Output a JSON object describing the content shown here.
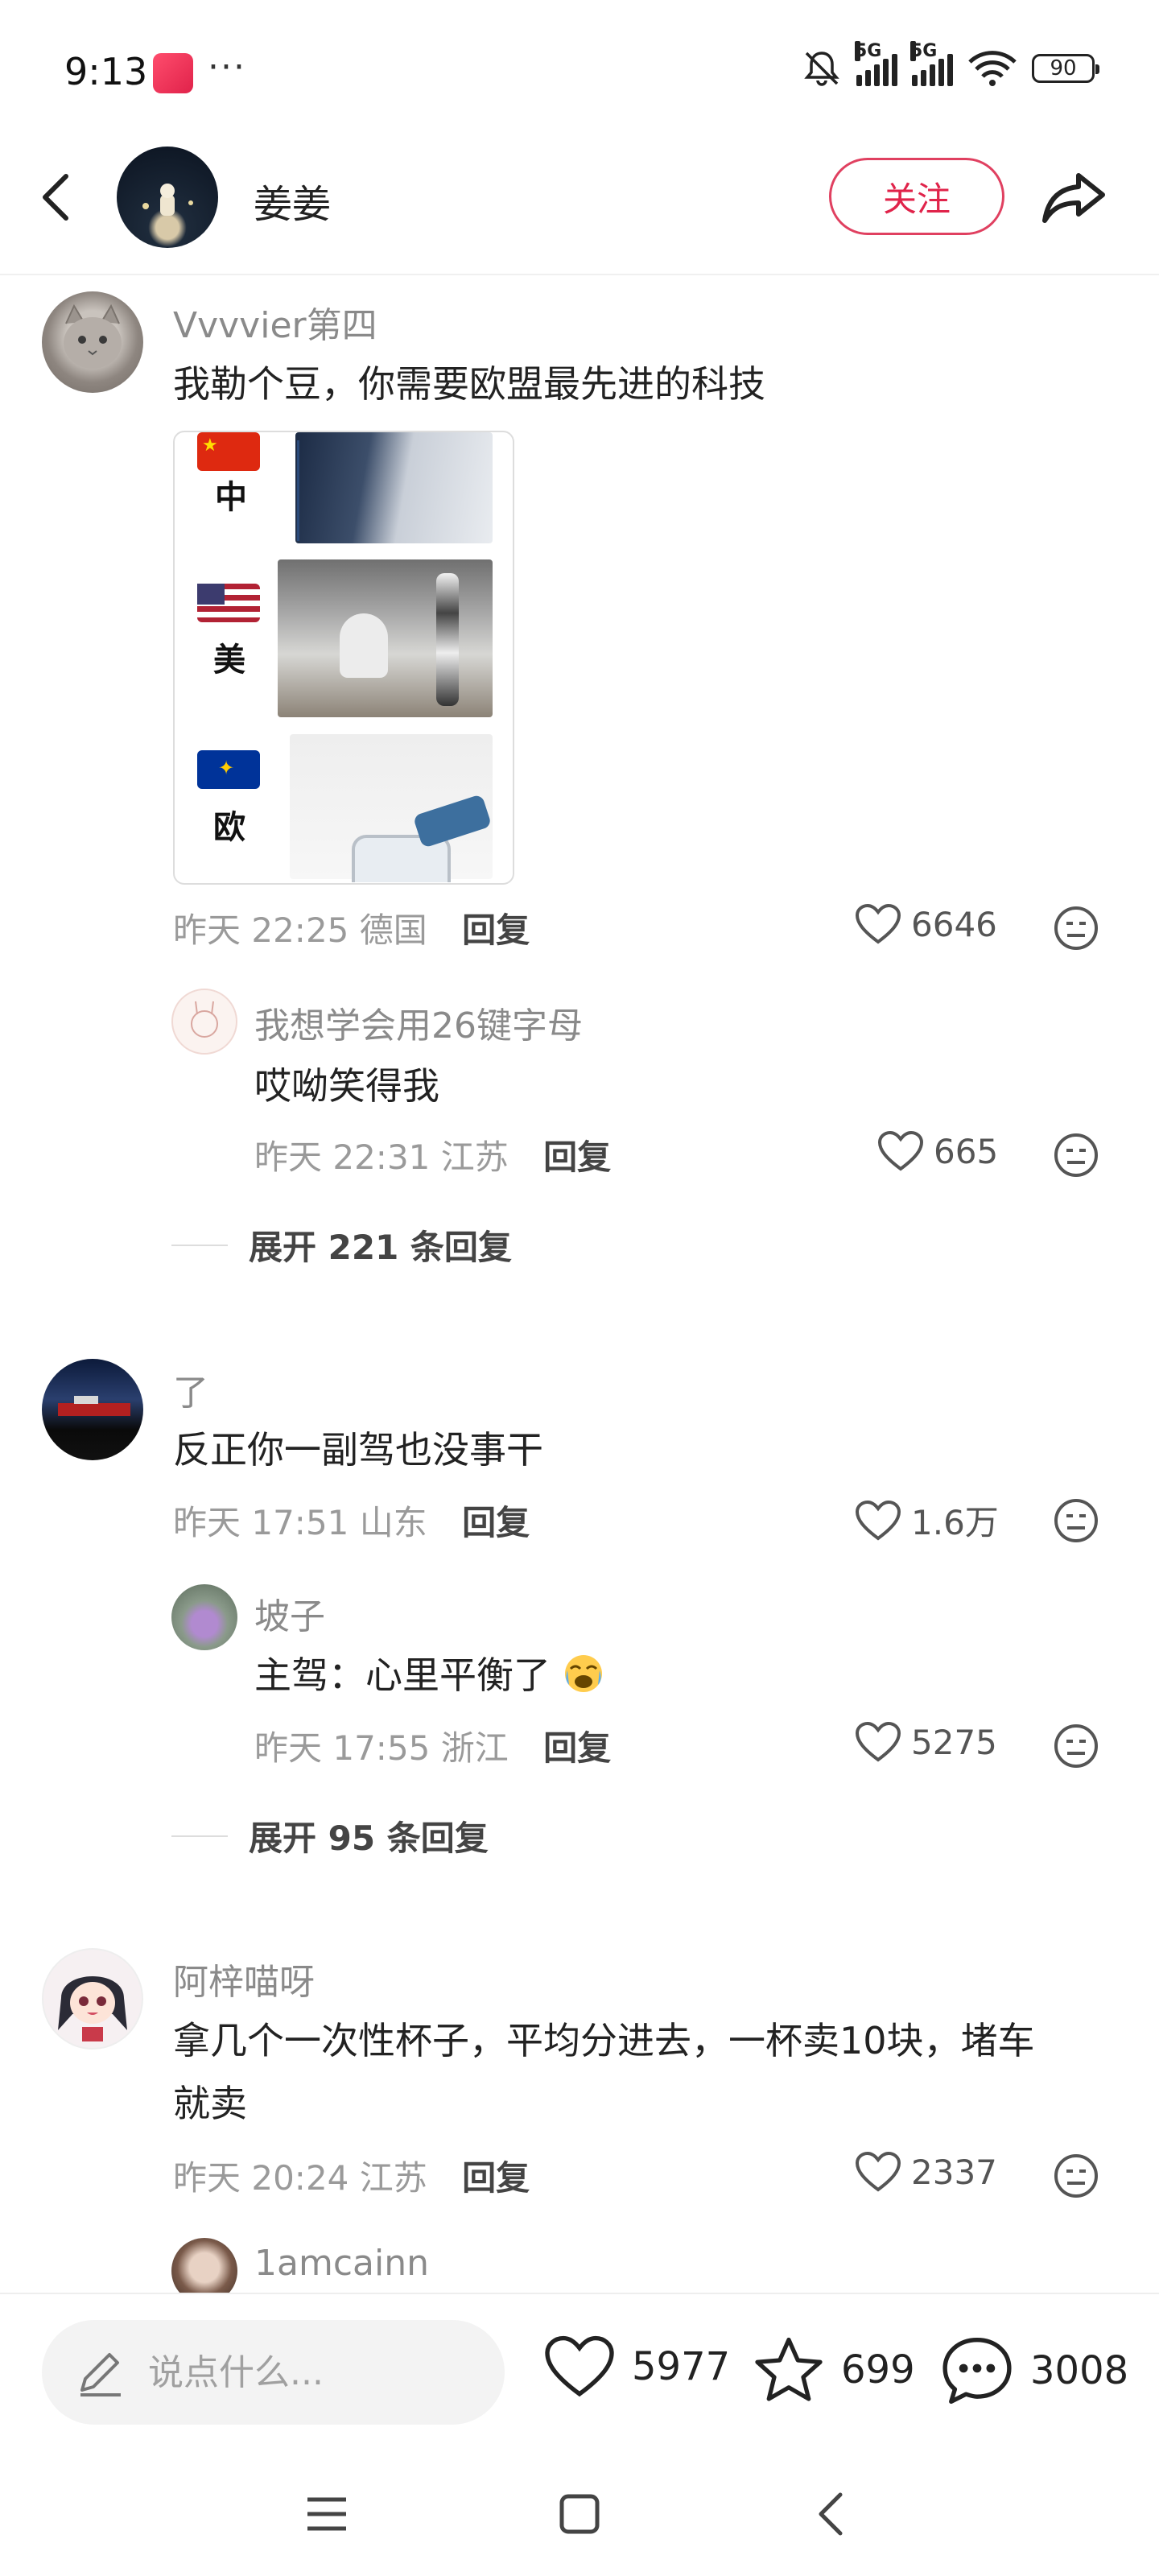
{
  "status_bar": {
    "time": "9:13",
    "dots": "···",
    "network_1": "5G",
    "network_2": "5G",
    "battery": "90"
  },
  "header": {
    "author_name": "姜姜",
    "follow_label": "关注"
  },
  "comments": [
    {
      "user": "Vvvvier第四",
      "text": "我勒个豆，你需要欧盟最先进的科技",
      "meme_labels": [
        "中",
        "美",
        "欧"
      ],
      "time": "昨天 22:25",
      "location": "德国",
      "reply_label": "回复",
      "likes": "6646",
      "reply": {
        "user": "我想学会用26键字母",
        "text": "哎呦笑得我",
        "time": "昨天 22:31",
        "location": "江苏",
        "reply_label": "回复",
        "likes": "665"
      },
      "expand": "展开 221 条回复"
    },
    {
      "user": "了",
      "text": "反正你一副驾也没事干",
      "time": "昨天 17:51",
      "location": "山东",
      "reply_label": "回复",
      "likes": "1.6万",
      "reply": {
        "user": "坡子",
        "text": "主驾：心里平衡了",
        "time": "昨天 17:55",
        "location": "浙江",
        "reply_label": "回复",
        "likes": "5275"
      },
      "expand": "展开 95 条回复"
    },
    {
      "user": "阿梓喵呀",
      "text_line1": "拿几个一次性杯子，平均分进去，一杯卖10块，堵车",
      "text_line2": "就卖",
      "time": "昨天 20:24",
      "location": "江苏",
      "reply_label": "回复",
      "likes": "2337",
      "reply": {
        "user": "1amcainn"
      }
    }
  ],
  "bottom_bar": {
    "input_placeholder": "说点什么...",
    "likes": "5977",
    "favorites": "699",
    "comments": "3008"
  },
  "colors": {
    "accent": "#e0234a",
    "text": "#222222",
    "muted": "#9a9a9a"
  },
  "icons": [
    "back-arrow-icon",
    "share-icon",
    "heart-icon",
    "emoji-icon",
    "pencil-icon",
    "star-icon",
    "chat-bubble-icon",
    "menu-icon",
    "home-square-icon",
    "nav-back-icon"
  ]
}
